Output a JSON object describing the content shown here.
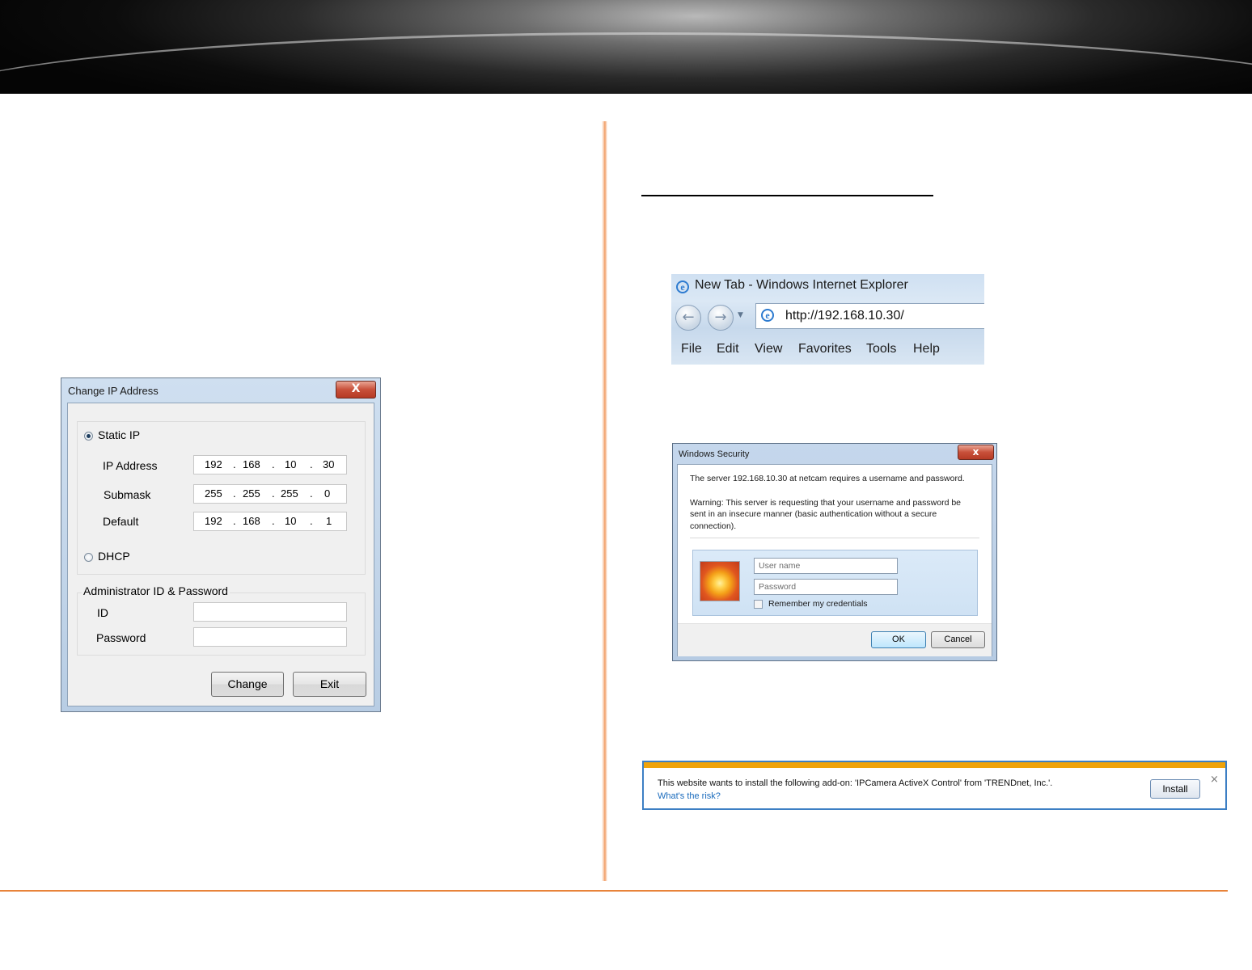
{
  "change_ip_dialog": {
    "title": "Change IP Address",
    "close_glyph": "X",
    "static_ip_label": "Static IP",
    "static_ip_selected": true,
    "ip_address_label": "IP Address",
    "ip_address": [
      "192",
      "168",
      "10",
      "30"
    ],
    "submask_label": "Submask",
    "submask": [
      "255",
      "255",
      "255",
      "0"
    ],
    "default_label": "Default",
    "default_gateway": [
      "192",
      "168",
      "10",
      "1"
    ],
    "dot": ".",
    "dhcp_label": "DHCP",
    "dhcp_selected": false,
    "admin_group_label": "Administrator ID & Password",
    "id_label": "ID",
    "id_value": "",
    "password_label": "Password",
    "password_value": "",
    "change_button": "Change",
    "exit_button": "Exit"
  },
  "ie_window": {
    "title": "New Tab - Windows Internet Explorer",
    "url": "http://192.168.10.30/",
    "menu": [
      "File",
      "Edit",
      "View",
      "Favorites",
      "Tools",
      "Help"
    ],
    "back_icon": "back-arrow-icon",
    "forward_icon": "forward-arrow-icon"
  },
  "security_dialog": {
    "title": "Windows Security",
    "close_glyph": "x",
    "message": "The server 192.168.10.30 at netcam requires a username and password.",
    "warning_lines": [
      "Warning: This server is requesting that your username and password be",
      "sent in an insecure manner (basic authentication without a secure",
      "connection)."
    ],
    "username_placeholder": "User name",
    "password_placeholder": "Password",
    "remember_label": "Remember my credentials",
    "ok_button": "OK",
    "cancel_button": "Cancel"
  },
  "addon_bar": {
    "message": "This website wants to install the following add-on: 'IPCamera ActiveX Control' from 'TRENDnet, Inc.'.",
    "risk_link": "What's the risk?",
    "install_button": "Install",
    "close_glyph": "×"
  },
  "colors": {
    "accent_orange": "#e8833a",
    "addon_stripe": "#f0a30a",
    "link_blue": "#1a6bbd"
  }
}
